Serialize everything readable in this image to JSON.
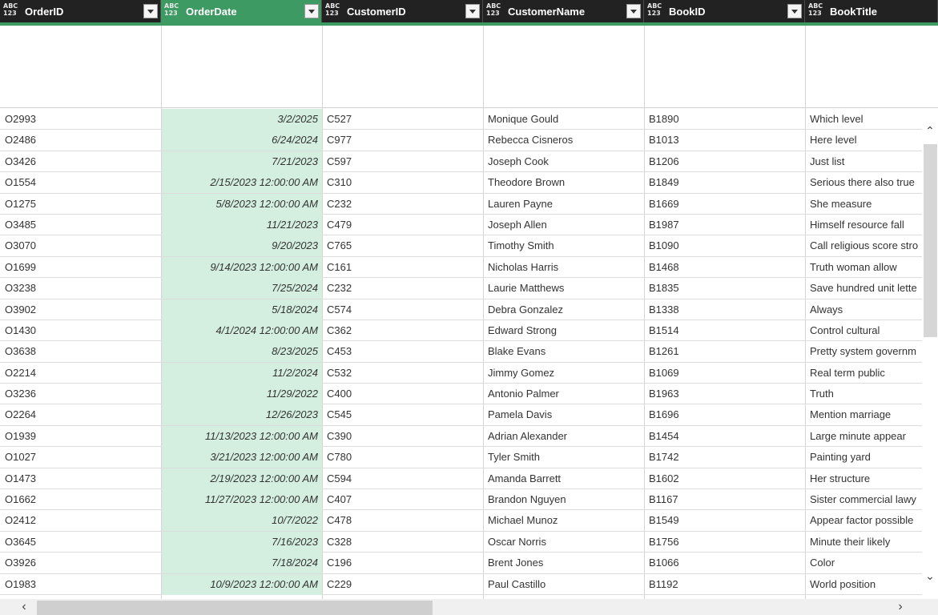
{
  "columns": [
    {
      "type_icon_top": "ABC",
      "type_icon_bottom": "123",
      "label": "OrderID"
    },
    {
      "type_icon_top": "ABC",
      "type_icon_bottom": "123",
      "label": "OrderDate"
    },
    {
      "type_icon_top": "ABC",
      "type_icon_bottom": "123",
      "label": "CustomerID"
    },
    {
      "type_icon_top": "ABC",
      "type_icon_bottom": "123",
      "label": "CustomerName"
    },
    {
      "type_icon_top": "ABC",
      "type_icon_bottom": "123",
      "label": "BookID"
    },
    {
      "type_icon_top": "ABC",
      "type_icon_bottom": "123",
      "label": "BookTitle"
    }
  ],
  "active_column": "OrderDate",
  "colors": {
    "header_bg": "#222222",
    "accent": "#3d9a63",
    "date_cell_bg": "#d4efe0"
  },
  "rows": [
    [
      "O2993",
      "3/2/2025",
      "C527",
      "Monique Gould",
      "B1890",
      "Which level"
    ],
    [
      "O2486",
      "6/24/2024",
      "C977",
      "Rebecca Cisneros",
      "B1013",
      "Here level"
    ],
    [
      "O3426",
      "7/21/2023",
      "C597",
      "Joseph Cook",
      "B1206",
      "Just list"
    ],
    [
      "O1554",
      "2/15/2023 12:00:00 AM",
      "C310",
      "Theodore Brown",
      "B1849",
      "Serious there also true"
    ],
    [
      "O1275",
      "5/8/2023 12:00:00 AM",
      "C232",
      "Lauren Payne",
      "B1669",
      "She measure"
    ],
    [
      "O3485",
      "11/21/2023",
      "C479",
      "Joseph Allen",
      "B1987",
      "Himself resource fall"
    ],
    [
      "O3070",
      "9/20/2023",
      "C765",
      "Timothy Smith",
      "B1090",
      "Call religious score stro"
    ],
    [
      "O1699",
      "9/14/2023 12:00:00 AM",
      "C161",
      "Nicholas Harris",
      "B1468",
      "Truth woman allow"
    ],
    [
      "O3238",
      "7/25/2024",
      "C232",
      "Laurie Matthews",
      "B1835",
      "Save hundred unit lette"
    ],
    [
      "O3902",
      "5/18/2024",
      "C574",
      "Debra Gonzalez",
      "B1338",
      "Always"
    ],
    [
      "O1430",
      "4/1/2024 12:00:00 AM",
      "C362",
      "Edward Strong",
      "B1514",
      "Control cultural"
    ],
    [
      "O3638",
      "8/23/2025",
      "C453",
      "Blake Evans",
      "B1261",
      "Pretty system governm"
    ],
    [
      "O2214",
      "11/2/2024",
      "C532",
      "Jimmy Gomez",
      "B1069",
      "Real term public"
    ],
    [
      "O3236",
      "11/29/2022",
      "C400",
      "Antonio Palmer",
      "B1963",
      "Truth"
    ],
    [
      "O2264",
      "12/26/2023",
      "C545",
      "Pamela Davis",
      "B1696",
      "Mention marriage"
    ],
    [
      "O1939",
      "11/13/2023 12:00:00 AM",
      "C390",
      "Adrian Alexander",
      "B1454",
      "Large minute appear"
    ],
    [
      "O1027",
      "3/21/2023 12:00:00 AM",
      "C780",
      "Tyler Smith",
      "B1742",
      "Painting yard"
    ],
    [
      "O1473",
      "2/19/2023 12:00:00 AM",
      "C594",
      "Amanda Barrett",
      "B1602",
      "Her structure"
    ],
    [
      "O1662",
      "11/27/2023 12:00:00 AM",
      "C407",
      "Brandon Nguyen",
      "B1167",
      "Sister commercial lawy"
    ],
    [
      "O2412",
      "10/7/2022",
      "C478",
      "Michael Munoz",
      "B1549",
      "Appear factor possible"
    ],
    [
      "O3645",
      "7/16/2023",
      "C328",
      "Oscar Norris",
      "B1756",
      "Minute their likely"
    ],
    [
      "O3926",
      "7/18/2024",
      "C196",
      "Brent Jones",
      "B1066",
      "Color"
    ],
    [
      "O1983",
      "10/9/2023 12:00:00 AM",
      "C229",
      "Paul Castillo",
      "B1192",
      "World position"
    ]
  ],
  "scroll_icons": {
    "up": "chevron-up-icon",
    "down": "chevron-down-icon",
    "left": "chevron-left-icon",
    "right": "chevron-right-icon"
  }
}
